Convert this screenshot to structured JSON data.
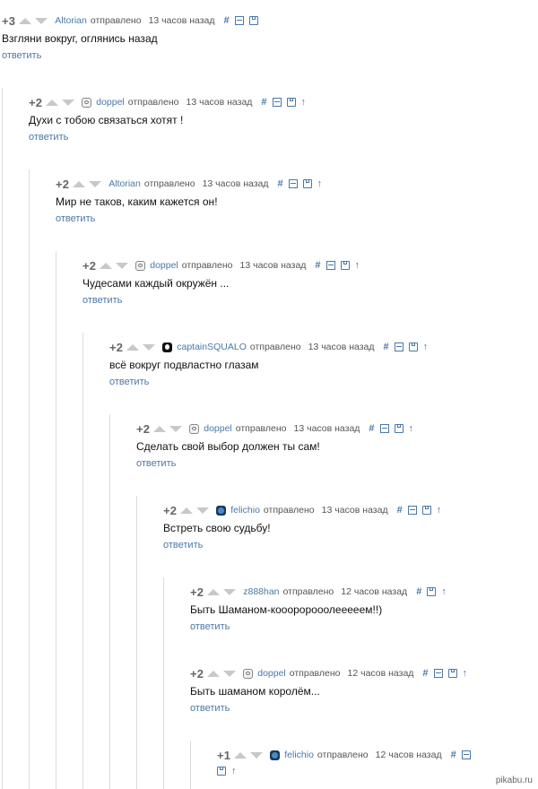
{
  "comments": [
    {
      "score": "+3",
      "author": "Altorian",
      "avatar": "none",
      "sent": "отправлено",
      "time": "13 часов назад",
      "icons": [
        "hash-icon",
        "collapse-icon",
        "save-icon"
      ],
      "text": "Взгляни вокруг, оглянись назад",
      "reply": "ответить"
    },
    {
      "score": "+2",
      "author": "doppel",
      "avatar": "ghost",
      "sent": "отправлено",
      "time": "13 часов назад",
      "icons": [
        "hash-icon",
        "collapse-icon",
        "save-icon",
        "parent-arrow-icon"
      ],
      "text": "Духи с тобою связаться хотят !",
      "reply": "ответить"
    },
    {
      "score": "+2",
      "author": "Altorian",
      "avatar": "none",
      "sent": "отправлено",
      "time": "13 часов назад",
      "icons": [
        "hash-icon",
        "collapse-icon",
        "save-icon",
        "parent-arrow-icon"
      ],
      "text": "Мир не таков, каким кажется он!",
      "reply": "ответить"
    },
    {
      "score": "+2",
      "author": "doppel",
      "avatar": "ghost",
      "sent": "отправлено",
      "time": "13 часов назад",
      "icons": [
        "hash-icon",
        "collapse-icon",
        "save-icon",
        "parent-arrow-icon"
      ],
      "text": "Чудесами каждый окружён ...",
      "reply": "ответить"
    },
    {
      "score": "+2",
      "author": "captainSQUALO",
      "avatar": "dark",
      "sent": "отправлено",
      "time": "13 часов назад",
      "icons": [
        "hash-icon",
        "collapse-icon",
        "save-icon",
        "parent-arrow-icon"
      ],
      "text": "всё вокруг подвластно глазам",
      "reply": "ответить"
    },
    {
      "score": "+2",
      "author": "doppel",
      "avatar": "ghost",
      "sent": "отправлено",
      "time": "13 часов назад",
      "icons": [
        "hash-icon",
        "collapse-icon",
        "save-icon",
        "parent-arrow-icon"
      ],
      "text": "Сделать свой выбор должен ты сам!",
      "reply": "ответить"
    },
    {
      "score": "+2",
      "author": "felichio",
      "avatar": "blue",
      "sent": "отправлено",
      "time": "13 часов назад",
      "icons": [
        "hash-icon",
        "collapse-icon",
        "save-icon",
        "parent-arrow-icon"
      ],
      "text": "Встреть свою судьбу!",
      "reply": "ответить"
    },
    {
      "score": "+2",
      "author": "z888han",
      "avatar": "none",
      "sent": "отправлено",
      "time": "12 часов назад",
      "icons": [
        "hash-icon",
        "save-icon",
        "parent-arrow-icon"
      ],
      "text": "Быть Шаманом-коооророоолееееем!!)",
      "reply": "ответить"
    },
    {
      "score": "+2",
      "author": "doppel",
      "avatar": "ghost",
      "sent": "отправлено",
      "time": "12 часов назад",
      "icons": [
        "hash-icon",
        "collapse-icon",
        "save-icon",
        "parent-arrow-icon"
      ],
      "text": "Быть шаманом королём...",
      "reply": "ответить"
    },
    {
      "score": "+1",
      "author": "felichio",
      "avatar": "blue",
      "sent": "отправлено",
      "time": "12 часов назад",
      "icons": [
        "hash-icon",
        "collapse-icon"
      ],
      "icons2": [
        "save-icon",
        "parent-arrow-icon"
      ],
      "text": "",
      "reply": ""
    }
  ],
  "watermark": "pikabu.ru",
  "colors": {
    "link": "#4a78a8",
    "thread_line": "#dcdcdc",
    "vote_arrow": "#c8c8c8"
  }
}
